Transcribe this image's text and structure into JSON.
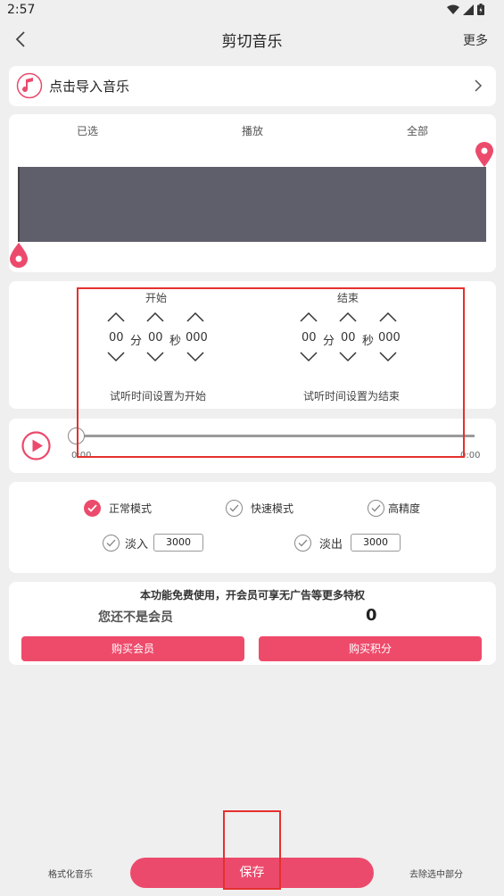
{
  "status_bar": {
    "time": "2:57"
  },
  "header": {
    "title": "剪切音乐",
    "more_label": "更多"
  },
  "import": {
    "label": "点击导入音乐"
  },
  "waveform": {
    "selected_label": "已选",
    "play_label": "播放",
    "all_label": "全部"
  },
  "time_settings": {
    "start": {
      "title": "开始",
      "minutes": "00",
      "minute_unit": "分",
      "seconds": "00",
      "second_unit": "秒",
      "millis": "000",
      "hint": "试听时间设置为开始"
    },
    "end": {
      "title": "结束",
      "minutes": "00",
      "minute_unit": "分",
      "seconds": "00",
      "second_unit": "秒",
      "millis": "000",
      "hint": "试听时间设置为结束"
    }
  },
  "player": {
    "current_time": "0:00",
    "total_time": "0:00",
    "progress": 0
  },
  "modes": {
    "normal": {
      "label": "正常模式",
      "checked": true
    },
    "fast": {
      "label": "快速模式",
      "checked": false
    },
    "high_precision": {
      "label": "高精度",
      "checked": false
    },
    "fade_in": {
      "label": "淡入",
      "value": "3000",
      "checked": false
    },
    "fade_out": {
      "label": "淡出",
      "value": "3000",
      "checked": false
    }
  },
  "membership": {
    "promo": "本功能免费使用，开会员可享无广告等更多特权",
    "status": "您还不是会员",
    "points": "0",
    "buy_member_label": "购买会员",
    "buy_points_label": "购买积分"
  },
  "bottom": {
    "format_label": "格式化音乐",
    "save_label": "保存",
    "remove_label": "去除选中部分"
  },
  "colors": {
    "accent": "#ec4a6c",
    "highlight": "#e5302e",
    "waveform": "#5f5e6b"
  }
}
